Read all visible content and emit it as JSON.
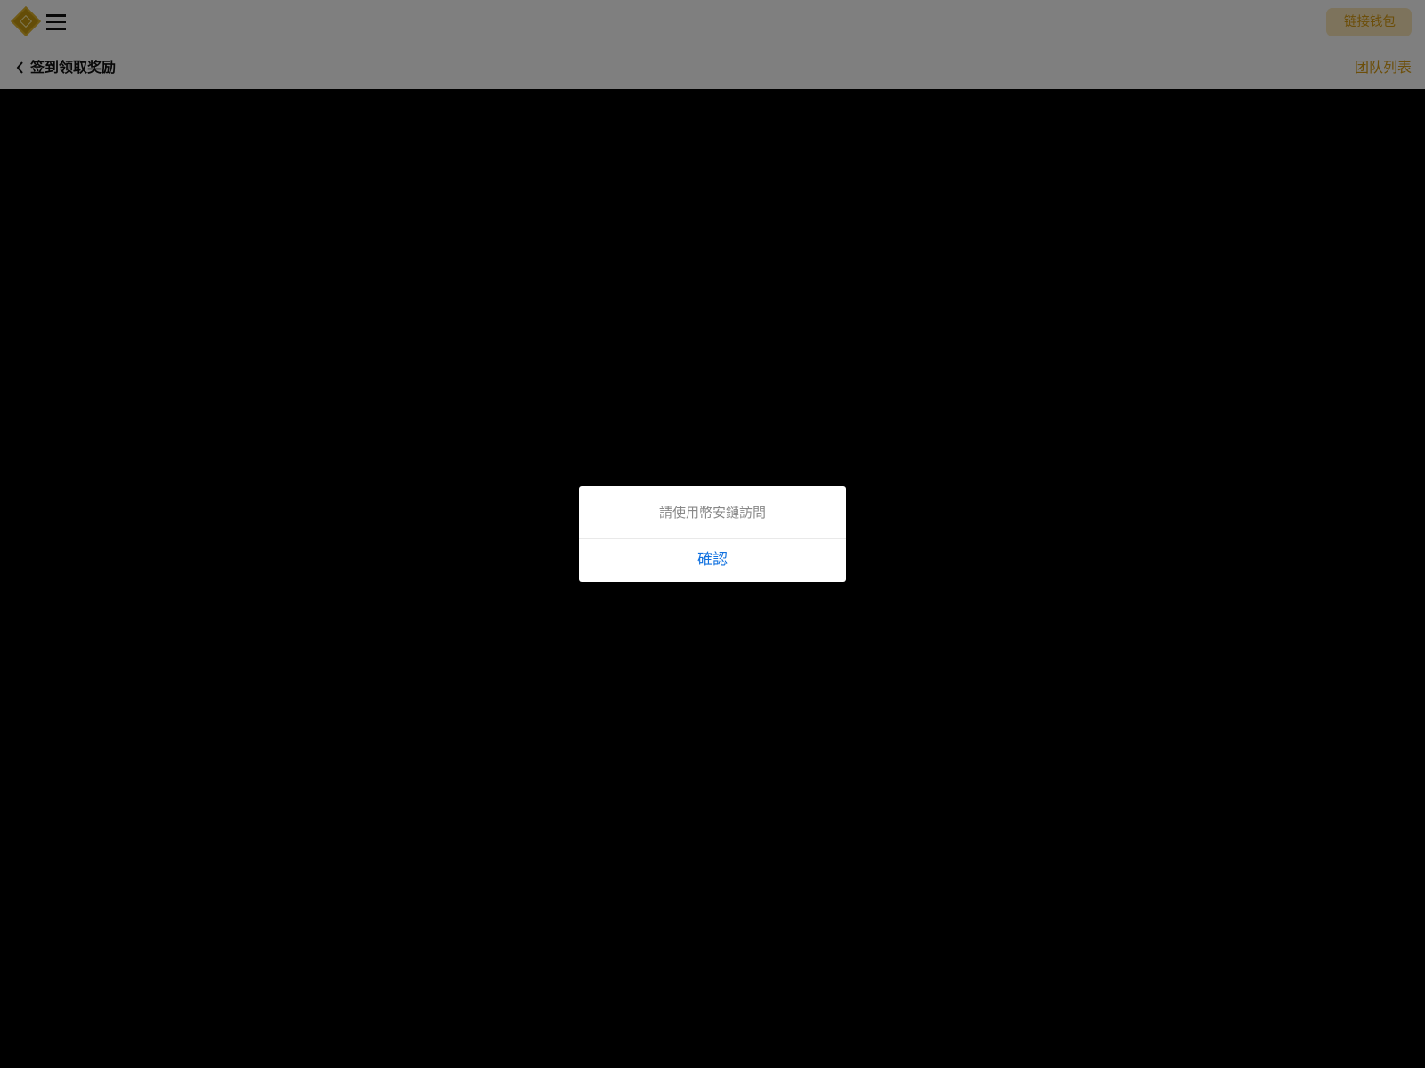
{
  "header": {
    "logo_icon": "diamond-logo-icon",
    "menu_icon": "hamburger-menu-icon",
    "wallet_button_label": "链接钱包",
    "back_icon": "chevron-left-icon",
    "page_title": "签到领取奖励",
    "team_link_label": "团队列表"
  },
  "dialog": {
    "message": "請使用幣安鏈訪問",
    "confirm_label": "確認"
  },
  "colors": {
    "accent": "#d99c12",
    "wallet_button_bg": "#fbe7b8",
    "dialog_confirm": "#1272e0",
    "overlay": "rgba(0,0,0,0.5)"
  }
}
